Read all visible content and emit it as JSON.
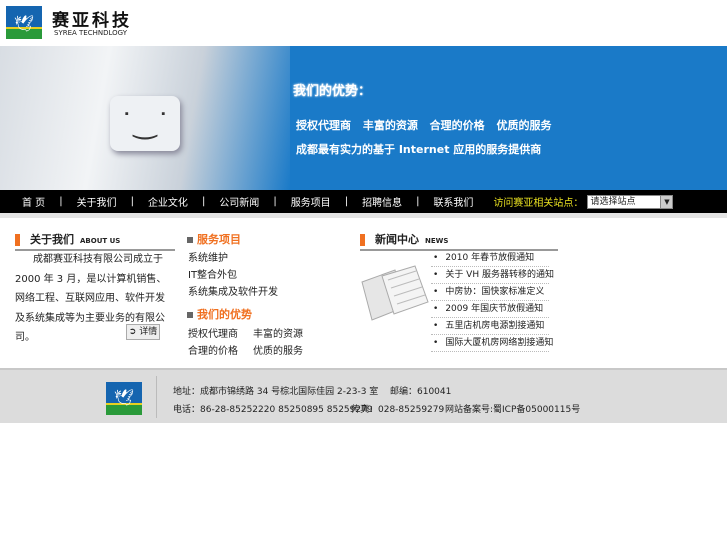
{
  "header": {
    "brand": "赛亚科技",
    "brand_en": "SYREA TECHNDLOGY"
  },
  "banner": {
    "title": "我们的优势：",
    "items": "授权代理商 丰富的资源 合理的价格 优质的服务",
    "tagline": "成都最有实力的基于 Internet 应用的服务提供商"
  },
  "nav": {
    "items": [
      "首 页",
      "关于我们",
      "企业文化",
      "公司新闻",
      "服务项目",
      "招聘信息",
      "联系我们"
    ],
    "visit_label": "访问赛亚相关站点：",
    "site_select": "请选择站点"
  },
  "about": {
    "title": "关于我们",
    "title_en": "ABOUT US",
    "text": "成都赛亚科技有限公司成立于 2000 年 3 月，是以计算机销售、网络工程、互联网应用、软件开发及系统集成等为主要业务的有限公司。",
    "detail": "详情"
  },
  "services": {
    "title": "服务项目",
    "items": [
      "系统维护",
      "IT整合外包",
      "系统集成及软件开发"
    ]
  },
  "advantages": {
    "title": "我们的优势",
    "items": [
      "授权代理商",
      "丰富的资源",
      "合理的价格",
      "优质的服务"
    ]
  },
  "news": {
    "title": "新闻中心",
    "title_en": "NEWS",
    "items": [
      "2010 年春节放假通知",
      "关于 VH 服务器转移的通知",
      "中房协：国快家标准定义",
      "2009 年国庆节放假通知",
      "五里店机房电源割接通知",
      "国际大厦机房网络割接通知"
    ]
  },
  "footer": {
    "address": "地址：成都市锦绣路 34 号棕北国际佳园 2-23-3 室",
    "postcode": "邮编：610041",
    "phone": "电话：86-28-85252220 85250895 85259279",
    "fax": "传真：028-85259279",
    "icp": "网站备案号:蜀ICP备05000115号"
  }
}
